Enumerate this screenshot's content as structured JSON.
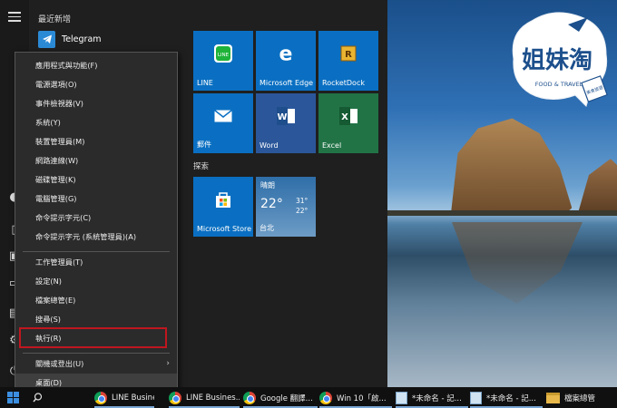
{
  "start_menu": {
    "recent_header": "最近新增",
    "recent_app": "Telegram",
    "tiles": [
      "LINE",
      "Microsoft Edge",
      "RocketDock",
      "郵件",
      "Word",
      "Excel"
    ],
    "section_explore": "探索",
    "explore_tiles": [
      "Microsoft Store"
    ],
    "weather": {
      "condition": "晴朗",
      "temp": "22°",
      "high": "31°",
      "low": "22°",
      "city": "台北"
    }
  },
  "context_menu": {
    "items": [
      "應用程式與功能(F)",
      "電源選項(O)",
      "事件檢視器(V)",
      "系統(Y)",
      "裝置管理員(M)",
      "網路連線(W)",
      "磁碟管理(K)",
      "電腦管理(G)",
      "命令提示字元(C)",
      "命令提示字元 (系統管理員)(A)",
      "工作管理員(T)",
      "設定(N)",
      "檔案總管(E)",
      "搜尋(S)",
      "執行(R)",
      "關機或登出(U)",
      "桌面(D)"
    ],
    "highlighted": "執行(R)"
  },
  "taskbar": {
    "items": [
      "LINE Business...",
      "LINE Busines...",
      "Google 翻譯...",
      "Win 10「啟...",
      "*未命名 - 記...",
      "*未命名 - 記...",
      "檔案總管"
    ]
  },
  "watermark": {
    "brand": "姐妹淘",
    "tagline": "FOOD & TRAVEL",
    "seal": "美食旅遊"
  },
  "colors": {
    "tile_blue": "#0a6fc2",
    "tile_excel": "#217346",
    "tile_word": "#2b579a",
    "highlight_border": "#c0161f",
    "accent": "#3c8fe0"
  }
}
